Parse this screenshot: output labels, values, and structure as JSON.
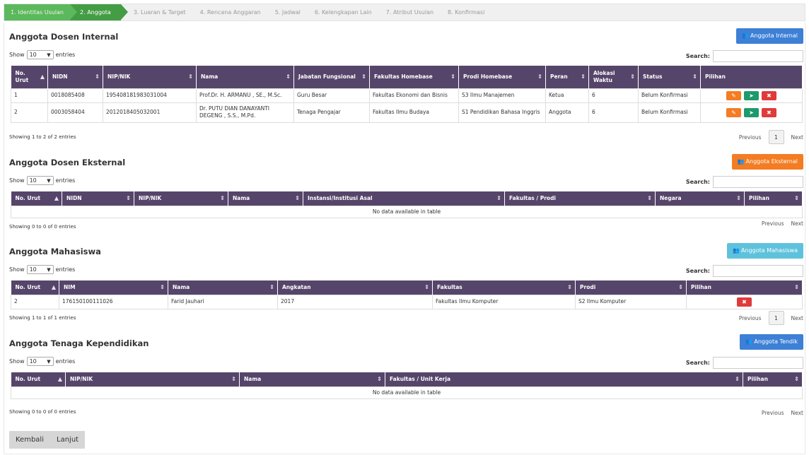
{
  "wizard": {
    "steps": [
      "1. Identitas Usulan",
      "2. Anggota",
      "3. Luaran & Target",
      "4. Rencana Anggaran",
      "5. Jadwal",
      "6. Kelengkapan Lain",
      "7. Atribut Usulan",
      "8. Konfirmasi"
    ]
  },
  "common": {
    "show": "Show",
    "entries": "entries",
    "entries_value": "10",
    "search": "Search:",
    "previous": "Previous",
    "next": "Next",
    "page": "1",
    "no_data": "No data available in table"
  },
  "internal": {
    "title": "Anggota Dosen Internal",
    "add_button": "Anggota Internal",
    "columns": [
      "No. Urut",
      "NIDN",
      "NIP/NIK",
      "Nama",
      "Jabatan Fungsional",
      "Fakultas Homebase",
      "Prodi Homebase",
      "Peran",
      "Alokasi Waktu",
      "Status",
      "Pilihan"
    ],
    "rows": [
      [
        "1",
        "0018085408",
        "195408181983031004",
        "Prof.Dr. H. ARMANU , SE., M.Sc.",
        "Guru Besar",
        "Fakultas Ekonomi dan Bisnis",
        "S3 Ilmu Manajemen",
        "Ketua",
        "6",
        "Belum Konfirmasi"
      ],
      [
        "2",
        "0003058404",
        "2012018405032001",
        "Dr. PUTU DIAN DANAYANTI DEGENG , S.S., M.Pd.",
        "Tenaga Pengajar",
        "Fakultas Ilmu Budaya",
        "S1 Pendidikan Bahasa Inggris",
        "Anggota",
        "6",
        "Belum Konfirmasi"
      ]
    ],
    "info": "Showing 1 to 2 of 2 entries"
  },
  "eksternal": {
    "title": "Anggota Dosen Eksternal",
    "add_button": "Anggota Eksternal",
    "columns": [
      "No. Urut",
      "NIDN",
      "NIP/NIK",
      "Nama",
      "Instansi/Institusi Asal",
      "Fakultas / Prodi",
      "Negara",
      "Pilihan"
    ],
    "info": "Showing 0 to 0 of 0 entries"
  },
  "mahasiswa": {
    "title": "Anggota Mahasiswa",
    "add_button": "Anggota Mahasiswa",
    "columns": [
      "No. Urut",
      "NIM",
      "Nama",
      "Angkatan",
      "Fakultas",
      "Prodi",
      "Pilihan"
    ],
    "rows": [
      [
        "2",
        "176150100111026",
        "Farid Jauhari",
        "2017",
        "Fakultas Ilmu Komputer",
        "S2 Ilmu Komputer"
      ]
    ],
    "info": "Showing 1 to 1 of 1 entries"
  },
  "tendik": {
    "title": "Anggota Tenaga Kependidikan",
    "add_button": "Anggota Tendik",
    "columns": [
      "No. Urut",
      "NIP/NIK",
      "Nama",
      "Fakultas / Unit Kerja",
      "Pilihan"
    ],
    "info": "Showing 0 to 0 of 0 entries"
  },
  "footer": {
    "back": "Kembali",
    "next": "Lanjut"
  },
  "icons": {
    "add": "user-plus-icon",
    "edit": "pencil-icon",
    "send": "paper-plane-icon",
    "delete": "times-icon"
  },
  "colors": {
    "header": "#56456a",
    "step_done": "#5cb85c",
    "step_active": "#449d44",
    "btn_blue": "#3d80d6",
    "btn_orange": "#f47c22",
    "btn_lightblue": "#5ec2dc"
  }
}
